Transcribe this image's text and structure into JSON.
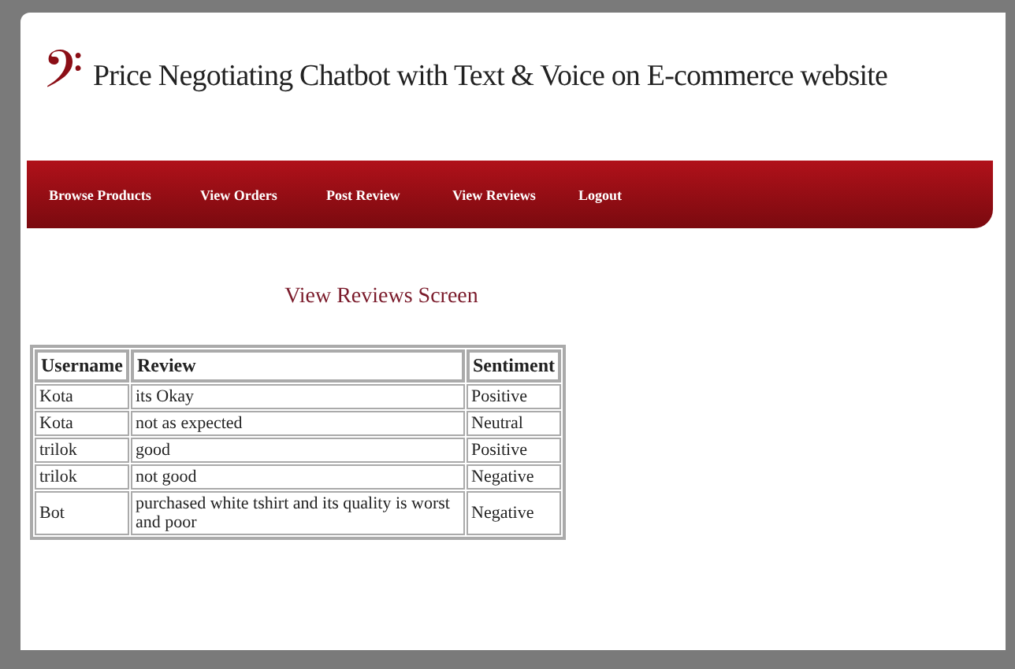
{
  "header": {
    "logo": "𝄢",
    "title": "Price Negotiating Chatbot with Text & Voice on E-commerce website"
  },
  "nav": [
    {
      "label": "Browse Products"
    },
    {
      "label": "View Orders"
    },
    {
      "label": "Post Review"
    },
    {
      "label": "View Reviews"
    },
    {
      "label": "Logout"
    }
  ],
  "page_title": "View Reviews Screen",
  "table": {
    "columns": [
      "Username",
      "Review",
      "Sentiment"
    ],
    "rows": [
      [
        "Kota",
        "its Okay",
        "Positive"
      ],
      [
        "Kota",
        "not as expected",
        "Neutral"
      ],
      [
        "trilok",
        "good",
        "Positive"
      ],
      [
        "trilok",
        "not good",
        "Negative"
      ],
      [
        "Bot",
        "purchased white tshirt and its quality is worst and poor",
        "Negative"
      ]
    ]
  }
}
